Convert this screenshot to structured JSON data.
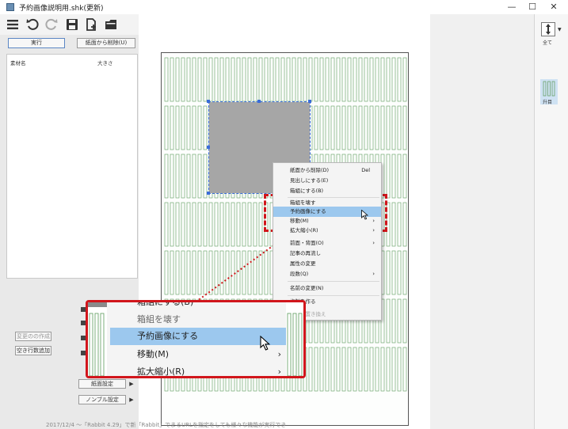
{
  "window": {
    "title": "予約画像説明用.shk(更新)",
    "minimize": "—",
    "maximize": "☐",
    "close": "✕"
  },
  "toolbar": {
    "icons": [
      "menu-icon",
      "undo-icon",
      "redo-icon",
      "save-icon",
      "new-file-icon",
      "folder-open-icon"
    ]
  },
  "left_panel": {
    "run_button": "実行",
    "remove_from_page_button": "紙面から削除(U)",
    "columns": [
      "素材名",
      "大きさ"
    ],
    "unset_button": "変更のの作成",
    "empty_line_button": "空き行数追加",
    "page_settings_button": "紙面設定",
    "nombre_settings_button": "ノンブル設定"
  },
  "right_side": {
    "all_label": "全て",
    "rise_label": "升目"
  },
  "context_menu": {
    "items": [
      {
        "label": "紙面から削除(D)",
        "shortcut": "Del",
        "disabled": false,
        "submenu": false
      },
      {
        "label": "見出しにする(E)",
        "shortcut": "",
        "disabled": false,
        "submenu": false
      },
      {
        "label": "箱組にする(B)",
        "shortcut": "",
        "disabled": false,
        "submenu": false
      },
      {
        "label": "箱組を壊す",
        "shortcut": "",
        "disabled": false,
        "submenu": false
      },
      {
        "label": "予約画像にする",
        "shortcut": "",
        "disabled": false,
        "submenu": false,
        "highlighted": true
      },
      {
        "label": "移動(M)",
        "shortcut": "",
        "disabled": false,
        "submenu": true
      },
      {
        "label": "拡大縮小(R)",
        "shortcut": "",
        "disabled": false,
        "submenu": true
      },
      {
        "label": "前面・背面(O)",
        "shortcut": "",
        "disabled": false,
        "submenu": true
      },
      {
        "label": "記事の再流し",
        "shortcut": "",
        "disabled": false,
        "submenu": false
      },
      {
        "label": "属性の変更",
        "shortcut": "",
        "disabled": false,
        "submenu": false
      },
      {
        "label": "段数(Q)",
        "shortcut": "",
        "disabled": false,
        "submenu": true
      },
      {
        "label": "名前の変更(N)",
        "shortcut": "",
        "disabled": false,
        "submenu": false
      },
      {
        "label": "複製を作る",
        "shortcut": "",
        "disabled": false,
        "submenu": false
      },
      {
        "label": "空白で置き換え",
        "shortcut": "",
        "disabled": true,
        "submenu": false
      }
    ]
  },
  "zoom_callout": {
    "items": [
      {
        "label": "箱組にする(B)",
        "submenu": false,
        "highlighted": false,
        "muted": false
      },
      {
        "label": "箱組を壊す",
        "submenu": false,
        "highlighted": false,
        "muted": true
      },
      {
        "label": "予約画像にする",
        "submenu": false,
        "highlighted": true,
        "muted": false
      },
      {
        "label": "移動(M)",
        "submenu": true,
        "highlighted": false,
        "muted": false
      },
      {
        "label": "拡大縮小(R)",
        "submenu": true,
        "highlighted": false,
        "muted": false
      }
    ]
  },
  "footer_text": "2017/12/4 ～「Rabbit 4.29」で新「Rabbit」でまるURLを指定をしても様々な機能が実行でき",
  "colors": {
    "accent_red": "#d1161c",
    "highlight_blue": "#9cc8ee",
    "grid_green": "#5c9c5c",
    "placeholder_gray": "#a6a6a6",
    "selection_blue": "#3a6cd8"
  }
}
